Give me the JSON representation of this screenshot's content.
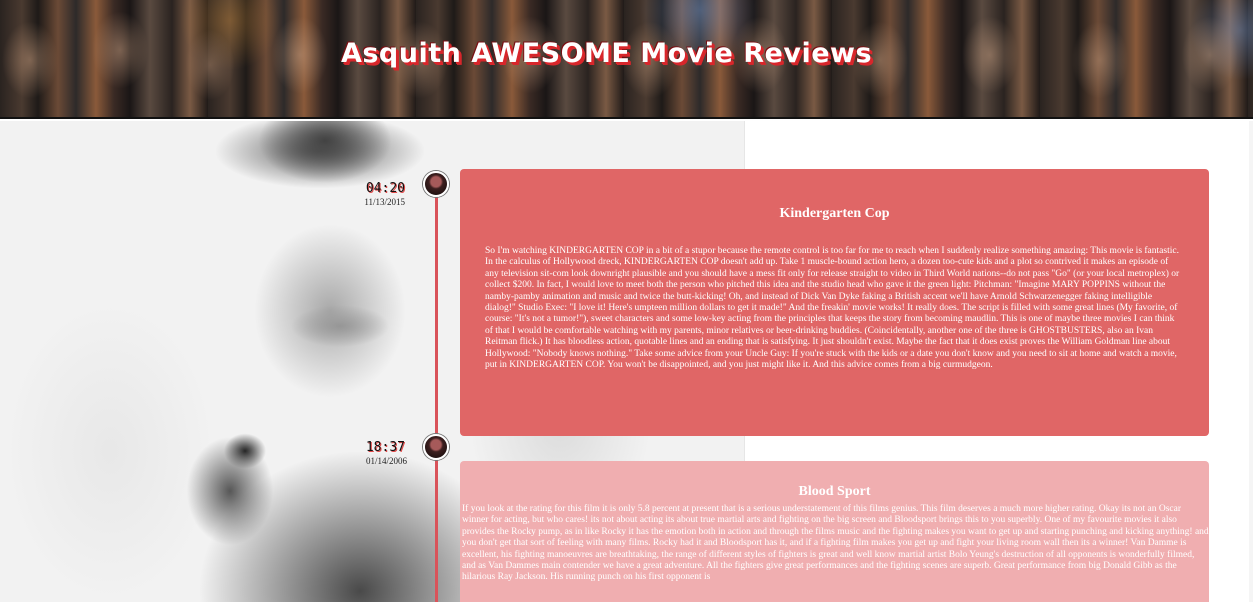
{
  "site": {
    "title": "Asquith AWESOME Movie Reviews"
  },
  "colors": {
    "accent_red": "#e06666",
    "accent_light": "#f0aeb0",
    "timeline": "#d9535a"
  },
  "timeline": {
    "entries": [
      {
        "time": "04:20",
        "date": "11/13/2015",
        "title": "Kindergarten Cop",
        "body": "So I'm watching KINDERGARTEN COP in a bit of a stupor because the remote control is too far for me to reach when I suddenly realize something amazing: This movie is fantastic. In the calculus of Hollywood dreck, KINDERGARTEN COP doesn't add up. Take 1 muscle-bound action hero, a dozen too-cute kids and a plot so contrived it makes an episode of any television sit-com look downright plausible and you should have a mess fit only for release straight to video in Third World nations--do not pass \"Go\" (or your local metroplex) or collect $200. In fact, I would love to meet both the person who pitched this idea and the studio head who gave it the green light: Pitchman: \"Imagine MARY POPPINS without the namby-pamby animation and music and twice the butt-kicking! Oh, and instead of Dick Van Dyke faking a British accent we'll have Arnold Schwarzenegger faking intelligible dialog!\" Studio Exec: \"I love it! Here's umpteen million dollars to get it made!\" And the freakin' movie works! It really does. The script is filled with some great lines (My favorite, of course: \"It's not a tumor!\"), sweet characters and some low-key acting from the principles that keeps the story from becoming maudlin. This is one of maybe three movies I can think of that I would be comfortable watching with my parents, minor relatives or beer-drinking buddies. (Coincidentally, another one of the three is GHOSTBUSTERS, also an Ivan Reitman flick.) It has bloodless action, quotable lines and an ending that is satisfying. It just shouldn't exist. Maybe the fact that it does exist proves the William Goldman line about Hollywood: \"Nobody knows nothing.\" Take some advice from your Uncle Guy: If you're stuck with the kids or a date you don't know and you need to sit at home and watch a movie, put in KINDERGARTEN COP. You won't be disappointed, and you just might like it. And this advice comes from a big curmudgeon."
      },
      {
        "time": "18:37",
        "date": "01/14/2006",
        "title": "Blood Sport",
        "body": "If you look at the rating for this film it is only 5.8 percent at present that is a serious understatement of this films genius. This film deserves a much more higher rating. Okay its not an Oscar winner for acting, but who cares! its not about acting its about true martial arts and fighting on the big screen and Bloodsport brings this to you superbly. One of my favourite movies it also provides the Rocky pump, as in like Rocky it has the emotion both in action and through the films music and the fighting makes you want to get up and starting punching and kicking anything! and you don't get that sort of feeling with many films. Rocky had it and Bloodsport has it, and if a fighting film makes you get up and fight your living room wall then its a winner! Van Damme is excellent, his fighting manoeuvres are breathtaking, the range of different styles of fighters is great and well know martial artist Bolo Yeung's destruction of all opponents is wonderfully filmed, and as Van Dammes main contender we have a great adventure. All the fighters give great performances and the fighting scenes are superb. Great performance from big Donald Gibb as the hilarious Ray Jackson. His running punch on his first opponent is"
      }
    ]
  }
}
